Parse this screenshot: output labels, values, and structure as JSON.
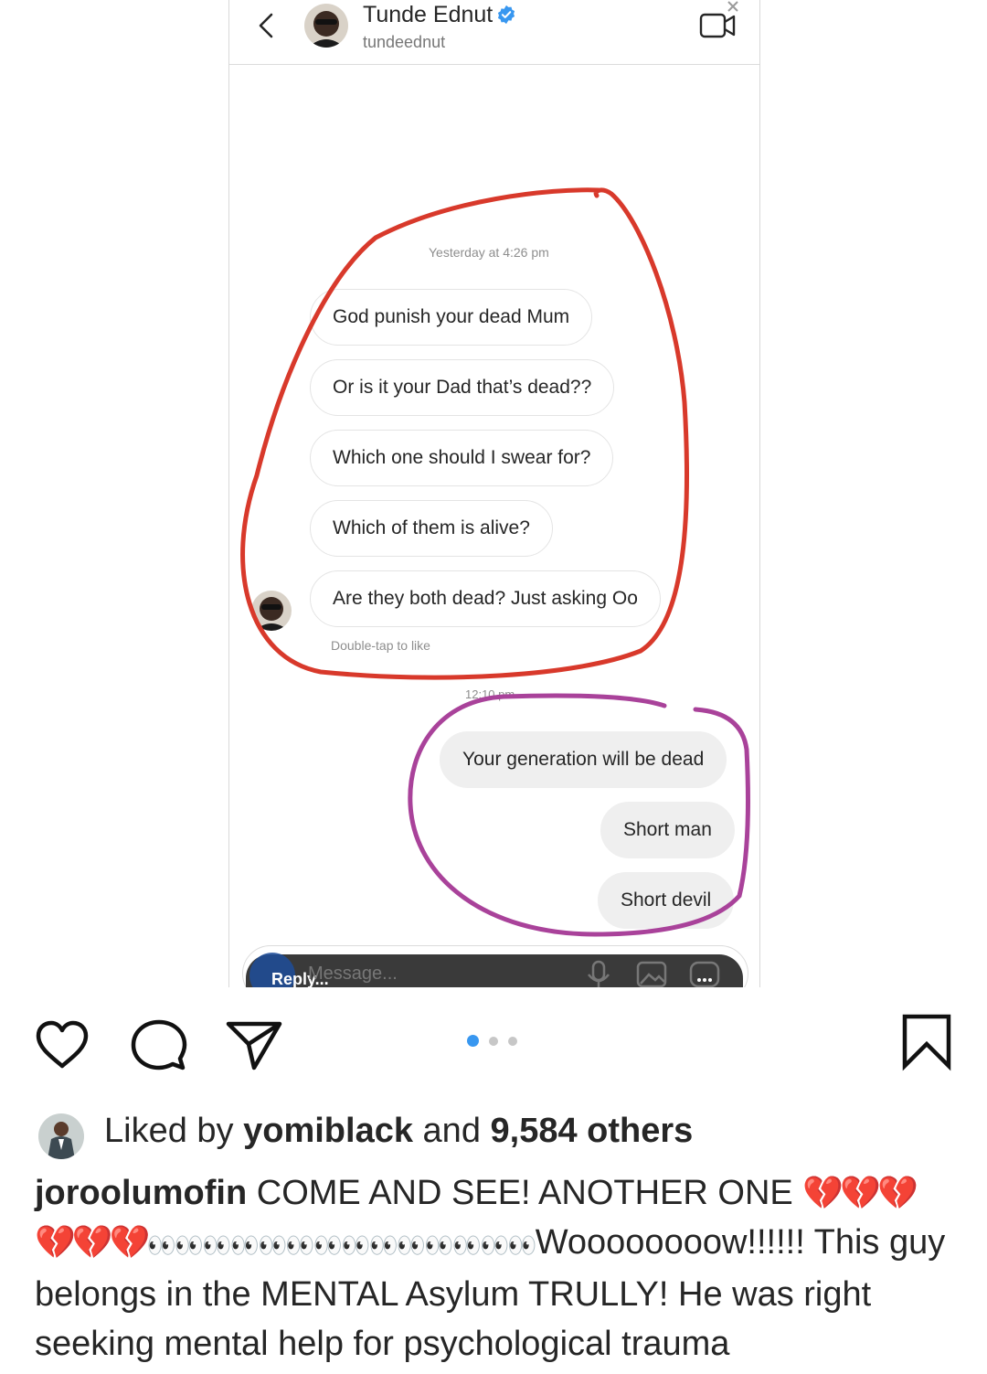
{
  "dm": {
    "contact_name": "Tunde Ednut",
    "contact_handle": "tundeednut",
    "timestamp_1": "Yesterday at 4:26 pm",
    "incoming_messages": [
      "God punish your dead Mum",
      "Or is it your Dad that’s dead??",
      "Which one should I swear for?",
      "Which of them is alive?",
      "Are they both dead? Just asking Oo"
    ],
    "double_tap_hint": "Double-tap to like",
    "timestamp_2": "12:10 pm",
    "outgoing_messages": [
      "Your generation will be dead",
      "Short man",
      "Short devil"
    ],
    "reply_label": "Reply...",
    "message_placeholder": "Message...",
    "annotation_colors": {
      "incoming_circle": "#d8392b",
      "outgoing_circle": "#a9429a"
    }
  },
  "post": {
    "liked_by_prefix": "Liked by",
    "liked_by_user": "yomiblack",
    "liked_by_and": "and",
    "liked_by_count": "9,584 others",
    "caption_user": "joroolumofin",
    "caption_part1": "COME AND SEE! ANOTHER ONE",
    "caption_hearts_1": "💔💔💔",
    "caption_hearts_2": "💔💔💔",
    "caption_eyes": "👀👀👀👀👀👀👀👀👀👀👀👀👀👀",
    "caption_part2": "Woooooooow!!!!!! This guy belongs in the MENTAL Asylum TRULLY! He was right seeking mental help for psychological trauma",
    "carousel": {
      "total": 3,
      "active": 1
    },
    "accent_color": "#3897f0"
  }
}
